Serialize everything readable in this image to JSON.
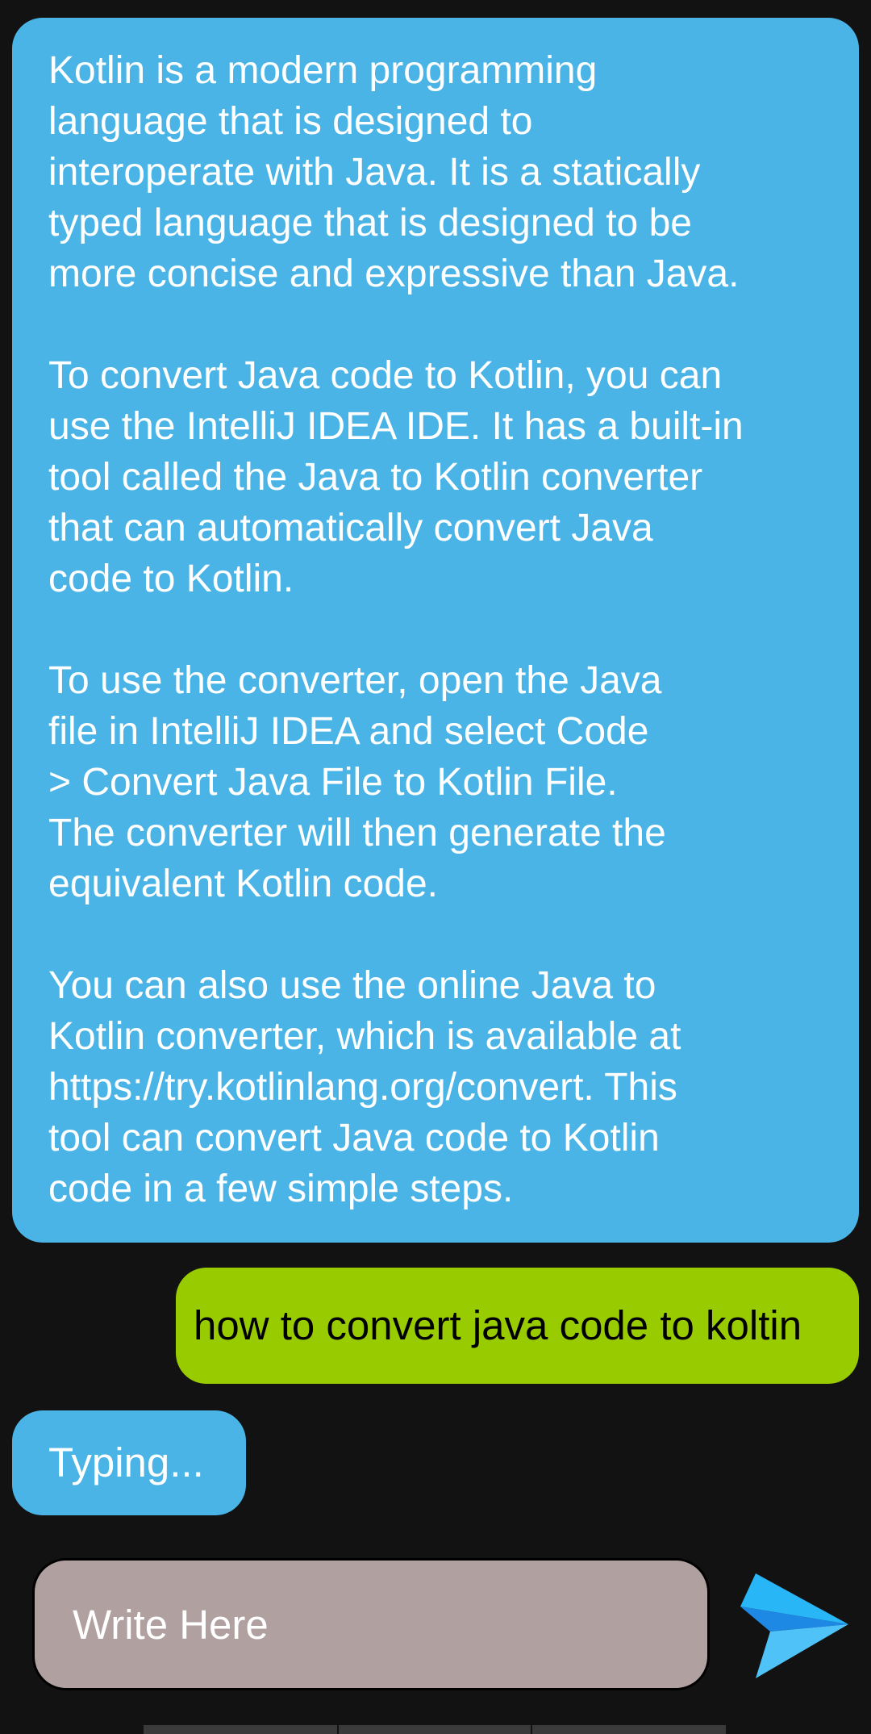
{
  "chat": {
    "bot_reply_paragraphs": [
      "Kotlin is a modern programming\nlanguage that is designed to\ninteroperate with Java. It is a statically\ntyped language that is designed to be\nmore concise and expressive than Java.",
      "To convert Java code to Kotlin, you can\nuse the IntelliJ IDEA IDE. It has a built-in\ntool called the Java to Kotlin converter\nthat can automatically convert Java\ncode to Kotlin.",
      "To use the converter, open the Java\nfile in IntelliJ IDEA and select Code\n> Convert Java File to Kotlin File.\nThe converter will then generate the\nequivalent Kotlin code.",
      "You can also use the online Java to\nKotlin converter, which is available at\nhttps://try.kotlinlang.org/convert. This\ntool can convert Java code to Kotlin\ncode in a few simple steps."
    ],
    "user_message": "how to convert java code to koltin",
    "typing_indicator": "Typing..."
  },
  "composer": {
    "placeholder": "Write Here",
    "send_icon": "send-icon"
  },
  "colors": {
    "bot_bubble": "#4bb4e6",
    "user_bubble": "#99cc00",
    "composer_bg": "#b0a1a0",
    "background": "#121212"
  }
}
